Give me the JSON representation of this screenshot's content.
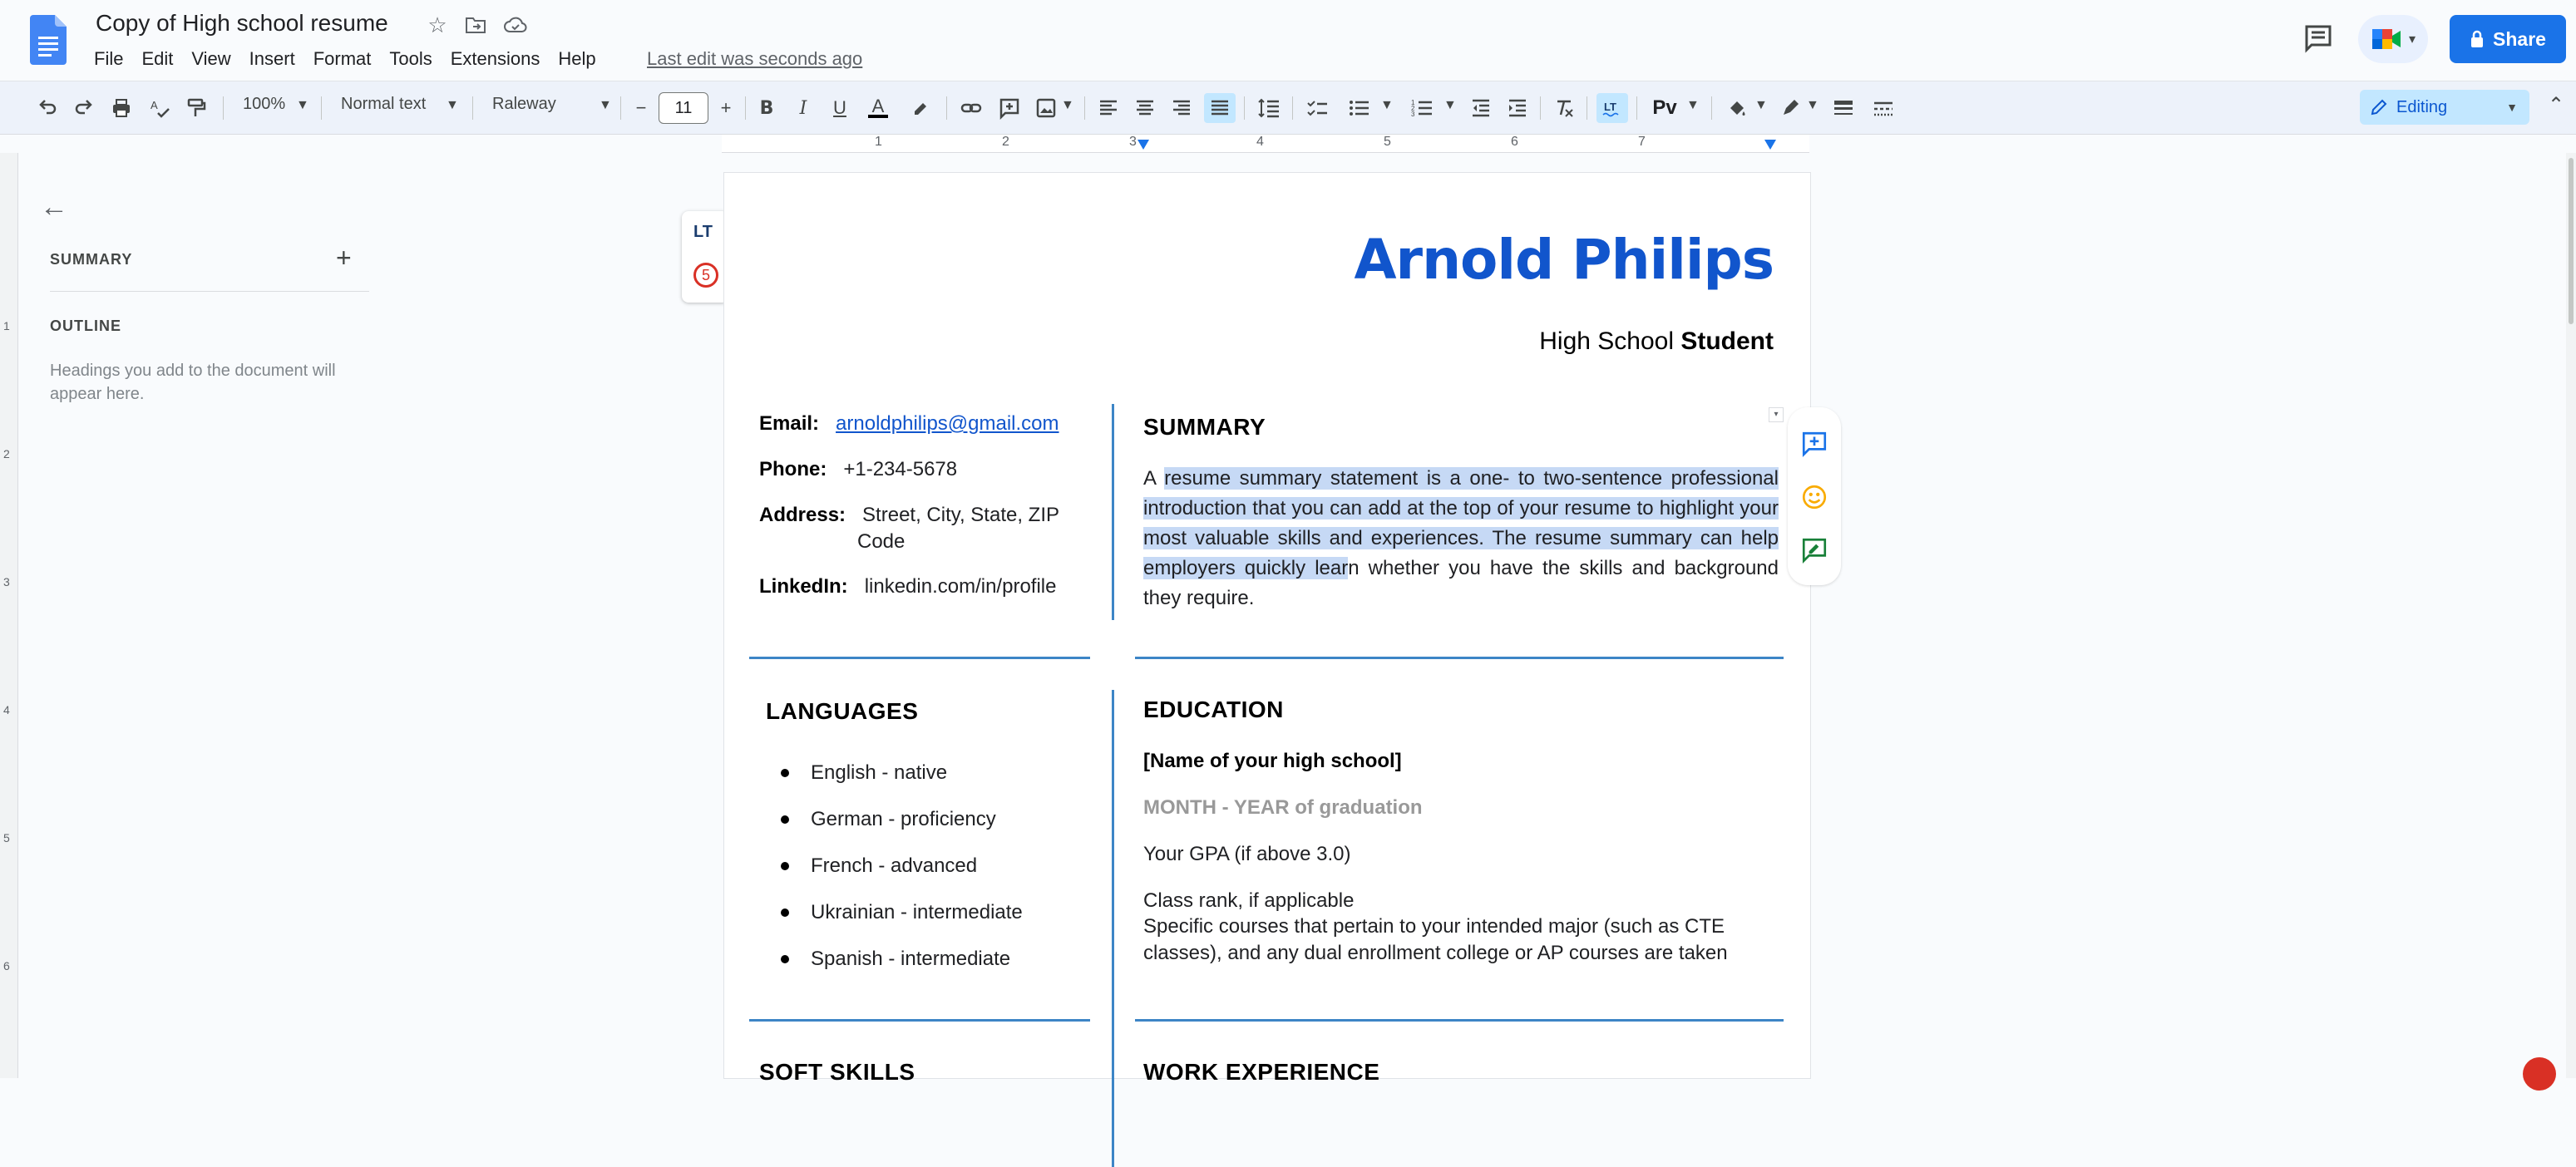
{
  "app": {
    "doc_title": "Copy of High school resume",
    "last_edit": "Last edit was seconds ago",
    "share_label": "Share",
    "menus": [
      "File",
      "Edit",
      "View",
      "Insert",
      "Format",
      "Tools",
      "Extensions",
      "Help"
    ]
  },
  "toolbar": {
    "zoom": "100%",
    "style": "Normal text",
    "font": "Raleway",
    "font_size": "11",
    "mode": "Editing"
  },
  "ruler": {
    "numbers": [
      "1",
      "2",
      "3",
      "4",
      "5",
      "6",
      "7"
    ],
    "vertical_numbers": [
      "1",
      "2",
      "3",
      "4",
      "5",
      "6"
    ]
  },
  "sidebar": {
    "summary_label": "SUMMARY",
    "outline_label": "OUTLINE",
    "outline_hint": "Headings you add to the document will appear here."
  },
  "lt_widget": {
    "logo": "LT",
    "issues": "5"
  },
  "doc": {
    "name": "Arnold Philips",
    "subtitle_pre": "High School ",
    "subtitle_bold": "Student",
    "contact": {
      "email_label": "Email:",
      "email_value": "arnoldphilips@gmail.com",
      "phone_label": "Phone:",
      "phone_value": "+1-234-5678",
      "address_label": "Address:",
      "address_line1": "Street, City, State, ZIP",
      "address_line2": "Code",
      "linkedin_label": "LinkedIn:",
      "linkedin_value": "linkedin.com/in/profile"
    },
    "summary_heading": "SUMMARY",
    "summary_text_pre": "A ",
    "summary_text_highlight": "resume summary statement is a one- to two-sentence professional introduction that you can add at the top of your resume to highlight your most valuable skills and experiences. The resume summary can help employers quickly lear",
    "summary_text_post": "n whether you have the skills and background they require.",
    "languages_heading": "LANGUAGES",
    "languages": [
      "English - native",
      "German - proficiency",
      "French - advanced",
      "Ukrainian - intermediate",
      "Spanish - intermediate"
    ],
    "education_heading": "EDUCATION",
    "school_name": "[Name of your high school]",
    "grad_date": "MONTH - YEAR of graduation",
    "gpa": "Your GPA (if above 3.0)",
    "class_rank": "Class rank, if applicable",
    "courses_line1": "Specific courses that pertain to your intended major (such as CTE",
    "courses_line2": "classes), and any dual enrollment college or AP courses are taken",
    "soft_skills_heading": "SOFT SKILLS",
    "work_heading": "WORK EXPERIENCE"
  },
  "colors": {
    "accent": "#1155cc",
    "rule": "#3d85c6",
    "share": "#1a73e8",
    "highlight": "#c6d9f5"
  }
}
